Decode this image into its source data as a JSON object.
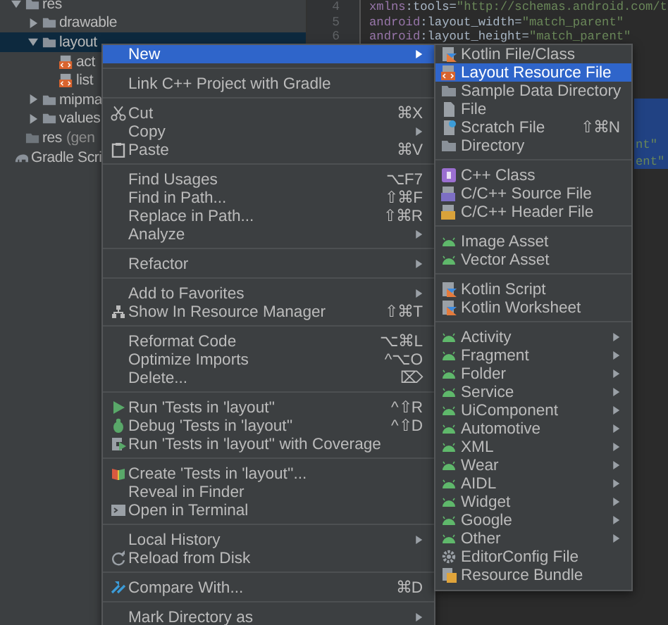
{
  "tree": {
    "items": [
      {
        "children": [
          {
            "label": "res",
            "expanded": true,
            "kind": "folder",
            "children": [
              {
                "label": "drawable",
                "expanded": false,
                "kind": "folder"
              },
              {
                "label": "layout",
                "expanded": true,
                "selected": true,
                "kind": "folder",
                "children": [
                  {
                    "label": "act",
                    "kind": "layout"
                  },
                  {
                    "label": "list",
                    "kind": "layout"
                  }
                ]
              },
              {
                "label": "mipma",
                "expanded": false,
                "kind": "folder"
              },
              {
                "label": "values",
                "expanded": false,
                "kind": "folder"
              }
            ]
          },
          {
            "label": "res",
            "note": "(gen",
            "kind": "generated"
          }
        ]
      },
      {
        "label": "Gradle Scri",
        "kind": "gradle"
      }
    ]
  },
  "gutter": {
    "line_numbers": [
      "4",
      "5",
      "6"
    ]
  },
  "editor": {
    "lines": [
      {
        "ns": "xmlns",
        "attr": ":tools=",
        "value": "\"http://schemas.android.com/t"
      },
      {
        "ns": "android",
        "attr": ":layout_width=",
        "value": "\"match_parent\""
      },
      {
        "ns": "android",
        "attr": ":layout_height=",
        "value": "\"match_parent\""
      }
    ],
    "selected_fragments": [
      "nt\"",
      "ent\""
    ]
  },
  "context_menu": {
    "sections": [
      [
        {
          "label": "New",
          "submenu": true,
          "selected": true,
          "kind": "plain"
        }
      ],
      [
        {
          "label": "Link C++ Project with Gradle",
          "selected": false,
          "kind": "plain"
        }
      ],
      [
        {
          "label": "Cut",
          "shortcut": "⌘X",
          "selected": false,
          "kind": "cut"
        },
        {
          "label": "Copy",
          "submenu": true,
          "selected": false,
          "kind": "plain"
        },
        {
          "label": "Paste",
          "shortcut": "⌘V",
          "selected": false,
          "kind": "paste"
        }
      ],
      [
        {
          "label": "Find Usages",
          "shortcut": "⌥F7",
          "selected": false,
          "kind": "plain"
        },
        {
          "label": "Find in Path...",
          "shortcut": "⇧⌘F",
          "selected": false,
          "kind": "plain"
        },
        {
          "label": "Replace in Path...",
          "shortcut": "⇧⌘R",
          "selected": false,
          "kind": "plain"
        },
        {
          "label": "Analyze",
          "submenu": true,
          "selected": false,
          "kind": "plain"
        }
      ],
      [
        {
          "label": "Refactor",
          "submenu": true,
          "selected": false,
          "kind": "plain"
        }
      ],
      [
        {
          "label": "Add to Favorites",
          "submenu": true,
          "selected": false,
          "kind": "plain"
        },
        {
          "label": "Show In Resource Manager",
          "shortcut": "⇧⌘T",
          "selected": false,
          "kind": "resource"
        }
      ],
      [
        {
          "label": "Reformat Code",
          "shortcut": "⌥⌘L",
          "selected": false,
          "kind": "plain"
        },
        {
          "label": "Optimize Imports",
          "shortcut": "^⌥O",
          "selected": false,
          "kind": "plain"
        },
        {
          "label": "Delete...",
          "shortcut": "⌦",
          "selected": false,
          "kind": "plain"
        }
      ],
      [
        {
          "label": "Run 'Tests in 'layout''",
          "shortcut": "^⇧R",
          "selected": false,
          "kind": "run"
        },
        {
          "label": "Debug 'Tests in 'layout''",
          "shortcut": "^⇧D",
          "selected": false,
          "kind": "debug"
        },
        {
          "label": "Run 'Tests in 'layout'' with Coverage",
          "selected": false,
          "kind": "coverage"
        }
      ],
      [
        {
          "label": "Create 'Tests in 'layout''...",
          "selected": false,
          "kind": "test"
        },
        {
          "label": "Reveal in Finder",
          "selected": false,
          "kind": "plain"
        },
        {
          "label": "Open in Terminal",
          "selected": false,
          "kind": "terminal"
        }
      ],
      [
        {
          "label": "Local History",
          "submenu": true,
          "selected": false,
          "kind": "plain"
        },
        {
          "label": "Reload from Disk",
          "selected": false,
          "kind": "reload"
        }
      ],
      [
        {
          "label": "Compare With...",
          "shortcut": "⌘D",
          "selected": false,
          "kind": "compare"
        }
      ],
      [
        {
          "label": "Mark Directory as",
          "submenu": true,
          "selected": false,
          "kind": "plain"
        }
      ]
    ]
  },
  "new_submenu": {
    "sections": [
      [
        {
          "label": "Kotlin File/Class",
          "selected": false,
          "kind": "kotlin"
        },
        {
          "label": "Layout Resource File",
          "selected": true,
          "kind": "layout"
        },
        {
          "label": "Sample Data Directory",
          "selected": false,
          "kind": "folder"
        },
        {
          "label": "File",
          "selected": false,
          "kind": "file"
        },
        {
          "label": "Scratch File",
          "shortcut": "⇧⌘N",
          "selected": false,
          "kind": "scratch"
        },
        {
          "label": "Directory",
          "selected": false,
          "kind": "folder"
        }
      ],
      [
        {
          "label": "C++ Class",
          "selected": false,
          "kind": "cppclass"
        },
        {
          "label": "C/C++ Source File",
          "selected": false,
          "kind": "source"
        },
        {
          "label": "C/C++ Header File",
          "selected": false,
          "kind": "header"
        }
      ],
      [
        {
          "label": "Image Asset",
          "selected": false,
          "kind": "android"
        },
        {
          "label": "Vector Asset",
          "selected": false,
          "kind": "android"
        }
      ],
      [
        {
          "label": "Kotlin Script",
          "selected": false,
          "kind": "kotlin"
        },
        {
          "label": "Kotlin Worksheet",
          "selected": false,
          "kind": "kotlin"
        }
      ],
      [
        {
          "label": "Activity",
          "submenu": true,
          "selected": false,
          "kind": "android"
        },
        {
          "label": "Fragment",
          "submenu": true,
          "selected": false,
          "kind": "android"
        },
        {
          "label": "Folder",
          "submenu": true,
          "selected": false,
          "kind": "android"
        },
        {
          "label": "Service",
          "submenu": true,
          "selected": false,
          "kind": "android"
        },
        {
          "label": "UiComponent",
          "submenu": true,
          "selected": false,
          "kind": "android"
        },
        {
          "label": "Automotive",
          "submenu": true,
          "selected": false,
          "kind": "android"
        },
        {
          "label": "XML",
          "submenu": true,
          "selected": false,
          "kind": "android"
        },
        {
          "label": "Wear",
          "submenu": true,
          "selected": false,
          "kind": "android"
        },
        {
          "label": "AIDL",
          "submenu": true,
          "selected": false,
          "kind": "android"
        },
        {
          "label": "Widget",
          "submenu": true,
          "selected": false,
          "kind": "android"
        },
        {
          "label": "Google",
          "submenu": true,
          "selected": false,
          "kind": "android"
        },
        {
          "label": "Other",
          "submenu": true,
          "selected": false,
          "kind": "android"
        },
        {
          "label": "EditorConfig File",
          "selected": false,
          "kind": "gear"
        },
        {
          "label": "Resource Bundle",
          "selected": false,
          "kind": "bundle"
        }
      ]
    ]
  }
}
